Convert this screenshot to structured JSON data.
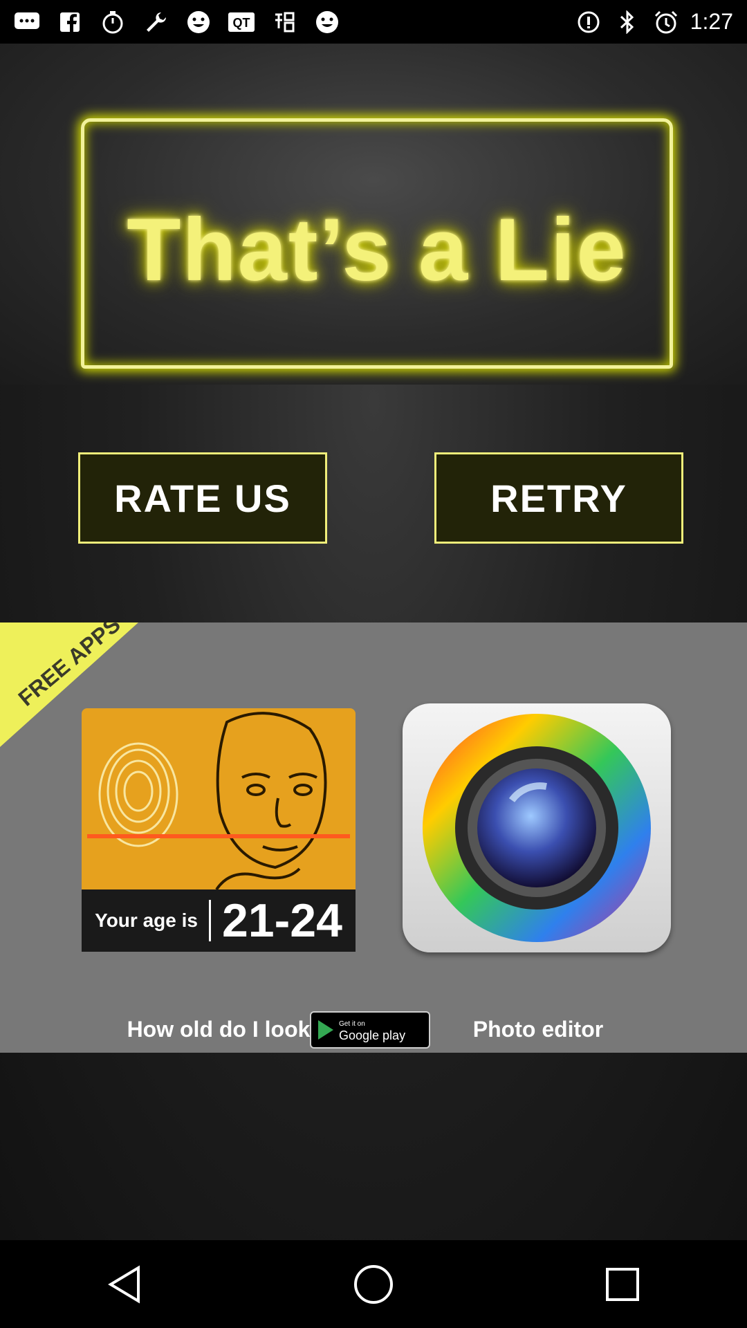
{
  "status_bar": {
    "time": "1:27",
    "icons": [
      "messages-icon",
      "facebook-icon",
      "timer-icon",
      "wrench-icon",
      "smiley-icon",
      "qt-icon",
      "chinese-app-icon",
      "smiley-icon",
      "info-icon",
      "bluetooth-icon",
      "alarm-icon"
    ]
  },
  "title": "That’s a Lie",
  "buttons": {
    "rate_us": "RATE US",
    "retry": "RETRY"
  },
  "promo": {
    "ribbon": "FREE APPS",
    "apps": [
      {
        "name": "How old do I look",
        "age_prefix": "Your age is",
        "age_range": "21-24"
      },
      {
        "name": "Photo editor"
      }
    ],
    "store_badge_small": "Get it on",
    "store_badge_big": "Google play"
  },
  "nav": [
    "back-icon",
    "home-icon",
    "recents-icon"
  ]
}
